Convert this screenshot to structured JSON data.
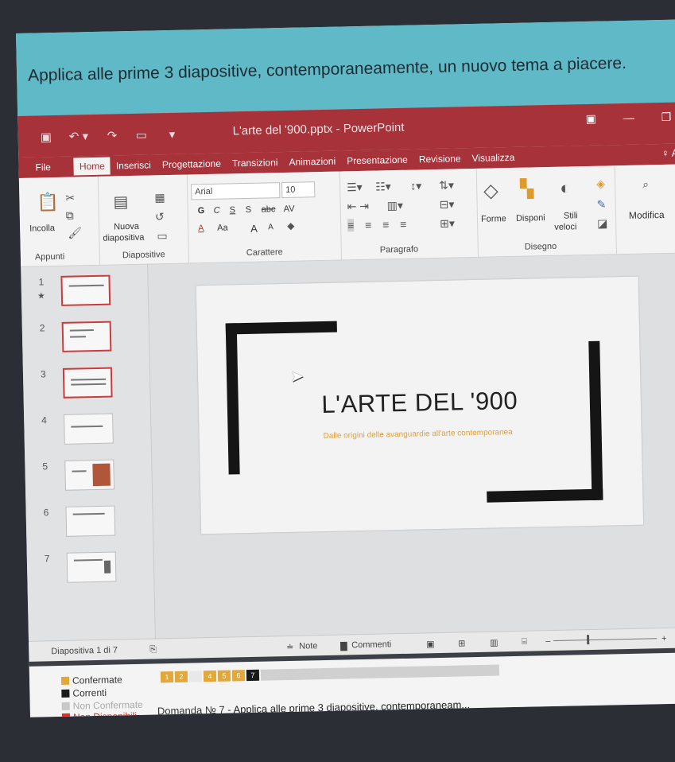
{
  "question": "Applica alle prime 3 diapositive, contemporaneamente, un nuovo tema a piacere.",
  "title_bar": {
    "doc_title": "L'arte del '900.pptx - PowerPoint"
  },
  "tabs": [
    "File",
    "Home",
    "Inserisci",
    "Progettazione",
    "Transizioni",
    "Animazioni",
    "Presentazione",
    "Revisione",
    "Visualizza"
  ],
  "active_tab": "Home",
  "ribbon": {
    "paste_label": "Incolla",
    "clipboard_label": "Appunti",
    "new_slide_line1": "Nuova",
    "new_slide_line2": "diapositiva",
    "slides_label": "Diapositive",
    "font_name": "Arial",
    "font_size": "10",
    "bold": "G",
    "italic": "C",
    "underline": "S",
    "strike": "S",
    "strike2": "abc",
    "spacing": "AV",
    "font_color": "A",
    "font_case": "Aa",
    "grow": "A",
    "shrink": "A",
    "font_label": "Carattere",
    "paragraph_label": "Paragrafo",
    "shapes_label": "Forme",
    "arrange_label": "Disponi",
    "styles_line1": "Stili",
    "styles_line2": "veloci",
    "drawing_label": "Disegno",
    "edit_label": "Modifica"
  },
  "thumbnails": [
    "1",
    "2",
    "3",
    "4",
    "5",
    "6",
    "7"
  ],
  "slide": {
    "title": "L'ARTE DEL '900",
    "subtitle": "Dalle origini delle avanguardie all'arte contemporanea"
  },
  "status": {
    "slide_counter": "Diapositiva 1 di 7",
    "notes": "Note",
    "comments": "Commenti",
    "zoom_plus": "+",
    "zoom_value": "5"
  },
  "legend": {
    "confirmed": "Confermate",
    "current": "Correnti",
    "unconfirmed": "Non Confermate",
    "unavailable": "Non Disponibili"
  },
  "question_numbers": [
    "1",
    "2",
    "",
    "4",
    "5",
    "6",
    "7"
  ],
  "question_prompt": {
    "number": "Domanda № 7 -",
    "text": "Applica alle prime 3 diapositive, contemporaneam..."
  },
  "colors": {
    "accent": "#a8323a",
    "question_bg": "#5fb9c7",
    "confirmed": "#e2a83a",
    "current": "#1a1a1a",
    "unconfirmed": "#c8c8c8",
    "unavailable": "#d9322e"
  }
}
